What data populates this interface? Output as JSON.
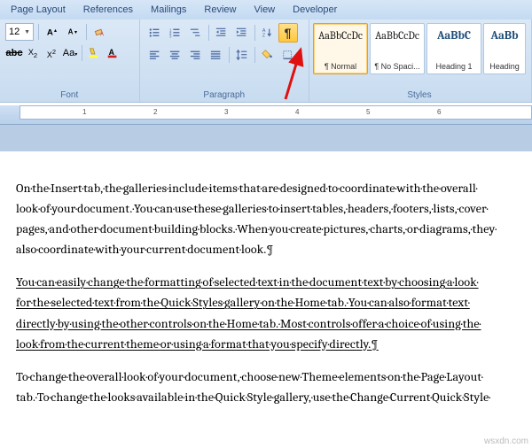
{
  "tabs": {
    "pageLayout": "Page Layout",
    "references": "References",
    "mailings": "Mailings",
    "review": "Review",
    "view": "View",
    "developer": "Developer"
  },
  "font": {
    "size": "12",
    "groupLabel": "Font"
  },
  "paragraph": {
    "groupLabel": "Paragraph"
  },
  "styles": {
    "groupLabel": "Styles",
    "items": [
      {
        "preview": "AaBbCcDc",
        "name": "¶ Normal"
      },
      {
        "preview": "AaBbCcDc",
        "name": "¶ No Spaci..."
      },
      {
        "preview": "AaBbC",
        "name": "Heading 1"
      },
      {
        "preview": "AaBb",
        "name": "Heading"
      }
    ]
  },
  "ruler": {
    "ticks": [
      "1",
      "2",
      "3",
      "4",
      "5",
      "6"
    ]
  },
  "document": {
    "p1": "On·the·Insert·tab,·the·galleries·include·items·that·are·designed·to·coordinate·with·the·overall· look·of·your·document.·You·can·use·these·galleries·to·insert·tables,·headers,·footers,·lists,·cover· pages,·and·other·document·building·blocks.·When·you·create·pictures,·charts,·or·diagrams,·they· also·coordinate·with·your·current·document·look.¶",
    "p2": "You·can·easily·change·the·formatting·of·selected·text·in·the·document·text·by·choosing·a·look· for·the·selected·text·from·the·Quick·Styles·gallery·on·the·Home·tab.·You·can·also·format·text· directly·by·using·the·other·controls·on·the·Home·tab.·Most·controls·offer·a·choice·of·using·the· look·from·the·current·theme·or·using·a·format·that·you·specify·directly.¶",
    "p3": "To·change·the·overall·look·of·your·document,·choose·new·Theme·elements·on·the·Page·Layout· tab.·To·change·the·looks·available·in·the·Quick·Style·gallery,·use·the·Change·Current·Quick·Style·"
  },
  "watermark": "wsxdn.com"
}
